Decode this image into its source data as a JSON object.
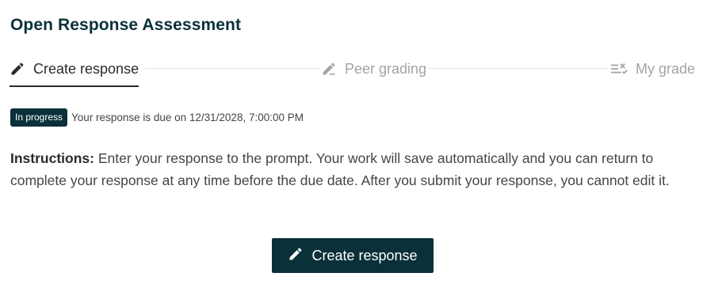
{
  "page": {
    "title": "Open Response Assessment"
  },
  "stepper": {
    "steps": [
      {
        "label": "Create response",
        "icon": "pencil-icon",
        "state": "active"
      },
      {
        "label": "Peer grading",
        "icon": "pencil-edit-icon",
        "state": "inactive"
      },
      {
        "label": "My grade",
        "icon": "grading-list-icon",
        "state": "inactive"
      }
    ]
  },
  "status": {
    "badge": "In progress",
    "due_text": "Your response is due on 12/31/2028, 7:00:00 PM"
  },
  "instructions": {
    "label": "Instructions:",
    "text": " Enter your response to the prompt. Your work will save automatically and you can return to complete your response at any time before the due date. After you submit your response, you cannot edit it."
  },
  "cta": {
    "label": "Create response",
    "icon": "pencil-icon"
  },
  "colors": {
    "brand_dark": "#0a3039",
    "inactive_text": "#a4a4a4",
    "body_text": "#454545"
  }
}
